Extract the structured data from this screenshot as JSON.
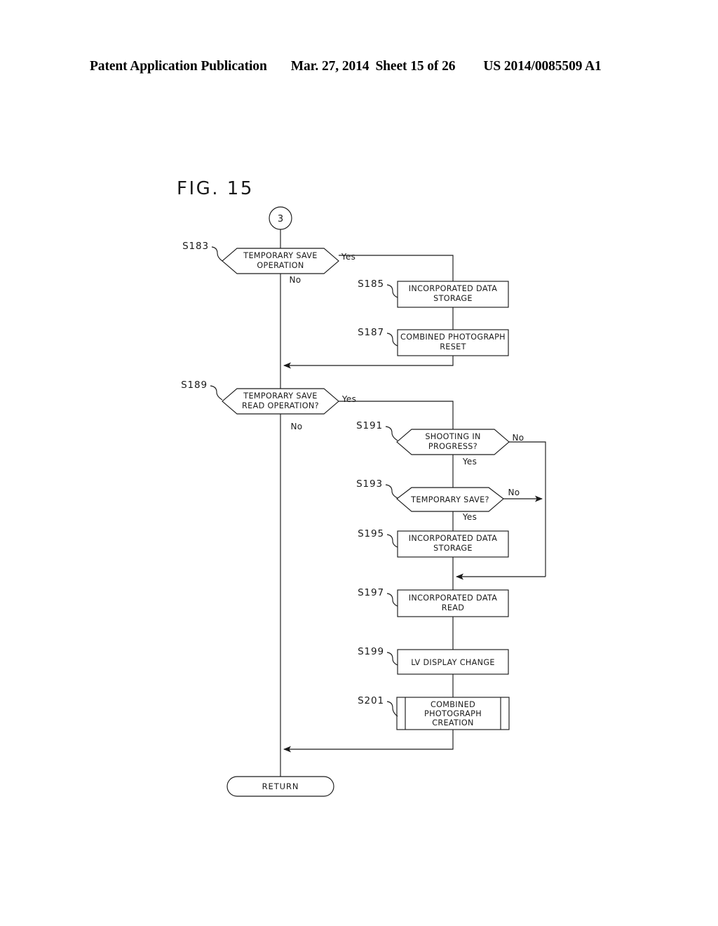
{
  "header": {
    "publication": "Patent Application Publication",
    "date": "Mar. 27, 2014",
    "sheet": "Sheet 15 of 26",
    "document_number": "US 2014/0085509 A1"
  },
  "figure": {
    "title": "FIG. 15",
    "entry_connector": "3",
    "terminal": "RETURN"
  },
  "chart_data": {
    "type": "diagram",
    "diagram_type": "flowchart",
    "title": "FIG. 15",
    "nodes": [
      {
        "id": "entry",
        "step": "",
        "shape": "connector-circle",
        "lines": [
          "3"
        ]
      },
      {
        "id": "S183",
        "step": "S183",
        "shape": "decision-hexagon",
        "lines": [
          "TEMPORARY SAVE",
          "OPERATION"
        ]
      },
      {
        "id": "S185",
        "step": "S185",
        "shape": "process-box",
        "lines": [
          "INCORPORATED DATA",
          "STORAGE"
        ]
      },
      {
        "id": "S187",
        "step": "S187",
        "shape": "process-box",
        "lines": [
          "COMBINED PHOTOGRAPH",
          "RESET"
        ]
      },
      {
        "id": "S189",
        "step": "S189",
        "shape": "decision-hexagon",
        "lines": [
          "TEMPORARY SAVE",
          "READ OPERATION?"
        ]
      },
      {
        "id": "S191",
        "step": "S191",
        "shape": "decision-hexagon",
        "lines": [
          "SHOOTING IN",
          "PROGRESS?"
        ]
      },
      {
        "id": "S193",
        "step": "S193",
        "shape": "decision-hexagon",
        "lines": [
          "TEMPORARY SAVE?"
        ]
      },
      {
        "id": "S195",
        "step": "S195",
        "shape": "process-box",
        "lines": [
          "INCORPORATED DATA",
          "STORAGE"
        ]
      },
      {
        "id": "S197",
        "step": "S197",
        "shape": "process-box",
        "lines": [
          "INCORPORATED DATA",
          "READ"
        ]
      },
      {
        "id": "S199",
        "step": "S199",
        "shape": "process-box",
        "lines": [
          "LV  DISPLAY CHANGE"
        ]
      },
      {
        "id": "S201",
        "step": "S201",
        "shape": "predefined-process-box",
        "lines": [
          "COMBINED",
          "PHOTOGRAPH",
          "CREATION"
        ]
      },
      {
        "id": "return",
        "step": "",
        "shape": "terminal-rounded",
        "lines": [
          "RETURN"
        ]
      }
    ],
    "edges": [
      {
        "from": "entry",
        "to": "S183",
        "label": ""
      },
      {
        "from": "S183",
        "to": "S185",
        "label": "Yes"
      },
      {
        "from": "S183",
        "to": "S189",
        "label": "No"
      },
      {
        "from": "S185",
        "to": "S187",
        "label": ""
      },
      {
        "from": "S187",
        "to": "S189",
        "label": ""
      },
      {
        "from": "S189",
        "to": "S191",
        "label": "Yes"
      },
      {
        "from": "S189",
        "to": "return",
        "label": "No"
      },
      {
        "from": "S191",
        "to": "S193",
        "label": "Yes"
      },
      {
        "from": "S191",
        "to": "S197",
        "label": "No"
      },
      {
        "from": "S193",
        "to": "S195",
        "label": "Yes"
      },
      {
        "from": "S193",
        "to": "S197",
        "label": "No"
      },
      {
        "from": "S195",
        "to": "S197",
        "label": ""
      },
      {
        "from": "S197",
        "to": "S199",
        "label": ""
      },
      {
        "from": "S199",
        "to": "S201",
        "label": ""
      },
      {
        "from": "S201",
        "to": "return",
        "label": ""
      }
    ]
  },
  "labels": {
    "yes": "Yes",
    "no": "No",
    "s183": "S183",
    "s185": "S185",
    "s187": "S187",
    "s189": "S189",
    "s191": "S191",
    "s193": "S193",
    "s195": "S195",
    "s197": "S197",
    "s199": "S199",
    "s201": "S201",
    "n_s183_l1": "TEMPORARY SAVE",
    "n_s183_l2": "OPERATION",
    "n_s185_l1": "INCORPORATED DATA",
    "n_s185_l2": "STORAGE",
    "n_s187_l1": "COMBINED PHOTOGRAPH",
    "n_s187_l2": "RESET",
    "n_s189_l1": "TEMPORARY SAVE",
    "n_s189_l2": "READ OPERATION?",
    "n_s191_l1": "SHOOTING IN",
    "n_s191_l2": "PROGRESS?",
    "n_s193_l1": "TEMPORARY SAVE?",
    "n_s195_l1": "INCORPORATED DATA",
    "n_s195_l2": "STORAGE",
    "n_s197_l1": "INCORPORATED DATA",
    "n_s197_l2": "READ",
    "n_s199_l1": "LV  DISPLAY CHANGE",
    "n_s201_l1": "COMBINED",
    "n_s201_l2": "PHOTOGRAPH",
    "n_s201_l3": "CREATION"
  },
  "colors": {
    "ink": "#1a1a1a",
    "paper": "#ffffff"
  }
}
